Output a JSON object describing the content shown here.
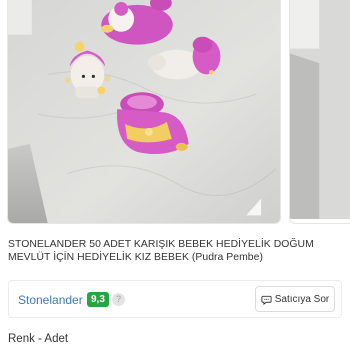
{
  "product": {
    "title": "STONELANDER 50 ADET KARIŞIK BEBEK HEDİYELİK DOĞUM MEVLÜT İÇİN HEDİYELİK KIZ BEBEK (Pudra Pembe)",
    "images": [
      {
        "alt": "Pink baby gift figurines on a marble surface"
      },
      {
        "alt": "Next product image"
      }
    ]
  },
  "seller": {
    "name": "Stonelander",
    "score": "9,3",
    "help_glyph": "?",
    "ask_button_label": "Satıcıya Sor"
  },
  "variant": {
    "section_title": "Renk - Adet"
  },
  "colors": {
    "seller_link": "#3a7ab8",
    "score_badge": "#26a541",
    "product_pink": "#d75bc4"
  }
}
